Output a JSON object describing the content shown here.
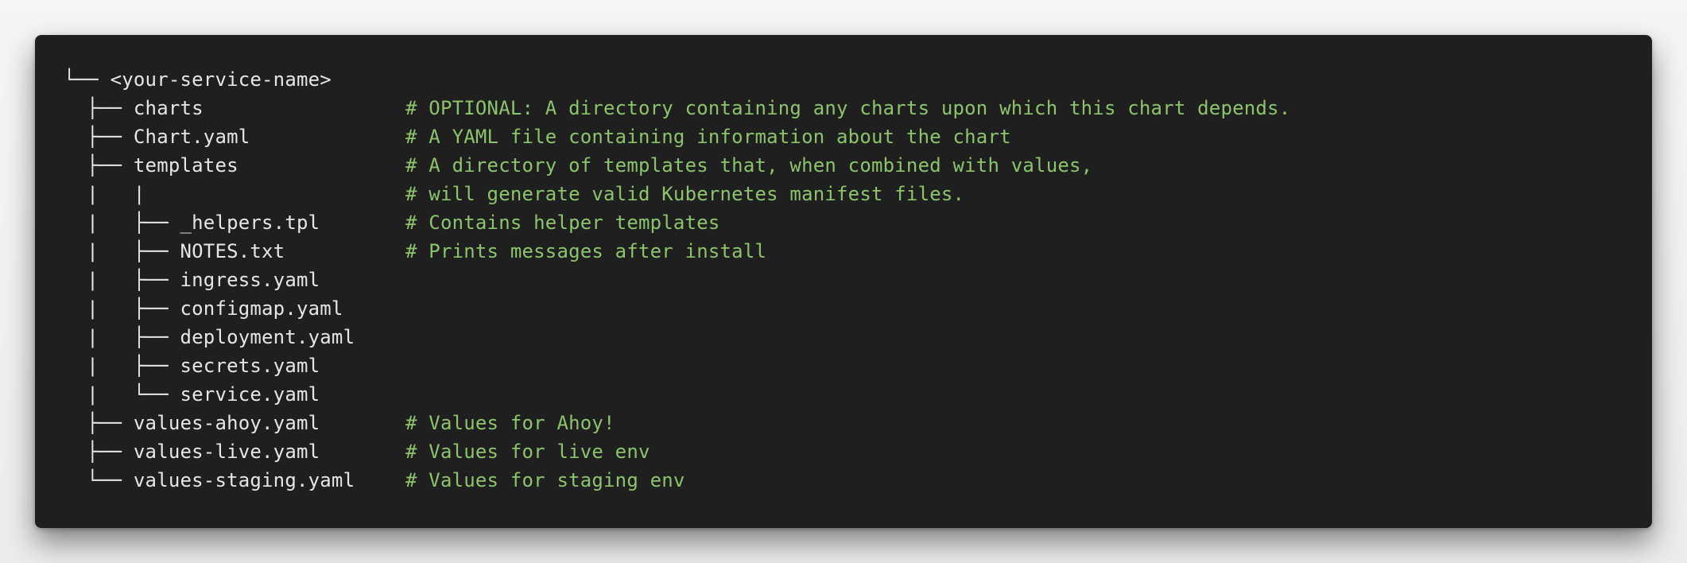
{
  "tree": {
    "root": "└── <your-service-name>",
    "lines": [
      {
        "entry": "  ├── charts",
        "comment": "# OPTIONAL: A directory containing any charts upon which this chart depends."
      },
      {
        "entry": "  ├── Chart.yaml",
        "comment": "# A YAML file containing information about the chart"
      },
      {
        "entry": "  ├── templates",
        "comment": "# A directory of templates that, when combined with values,"
      },
      {
        "entry": "  |   |",
        "comment": "# will generate valid Kubernetes manifest files."
      },
      {
        "entry": "  |   ├── _helpers.tpl",
        "comment": "# Contains helper templates"
      },
      {
        "entry": "  |   ├── NOTES.txt",
        "comment": "# Prints messages after install"
      },
      {
        "entry": "  |   ├── ingress.yaml",
        "comment": ""
      },
      {
        "entry": "  |   ├── configmap.yaml",
        "comment": ""
      },
      {
        "entry": "  |   ├── deployment.yaml",
        "comment": ""
      },
      {
        "entry": "  |   ├── secrets.yaml",
        "comment": ""
      },
      {
        "entry": "  |   └── service.yaml",
        "comment": ""
      },
      {
        "entry": "  ├── values-ahoy.yaml",
        "comment": "# Values for Ahoy!"
      },
      {
        "entry": "  ├── values-live.yaml",
        "comment": "# Values for live env"
      },
      {
        "entry": "  └── values-staging.yaml",
        "comment": "# Values for staging env"
      }
    ]
  },
  "colors": {
    "background": "#1f1f1f",
    "text": "#e6e6e6",
    "comment": "#8cc46b",
    "page": "#f3f3f3"
  }
}
